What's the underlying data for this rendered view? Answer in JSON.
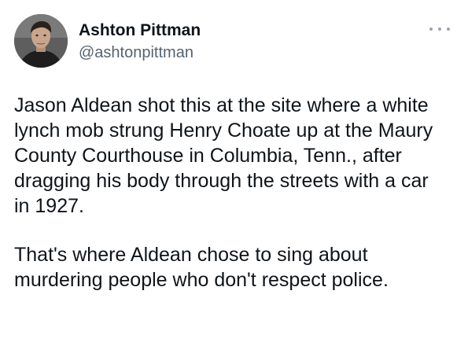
{
  "author": {
    "display_name": "Ashton Pittman",
    "handle": "@ashtonpittman",
    "avatar_icon": "user-avatar-photo"
  },
  "more_icon": "more-options-icon",
  "tweet": {
    "paragraphs": [
      "Jason Aldean shot this at the site where a white\nlynch mob strung Henry Choate up at the Maury\nCounty Courthouse in Columbia, Tenn., after\ndragging his body through the streets with a car\nin 1927.",
      "That's where Aldean chose to sing about\nmurdering people who don't respect police."
    ]
  },
  "colors": {
    "text": "#0f1419",
    "secondary": "#536471",
    "background": "#ffffff"
  }
}
